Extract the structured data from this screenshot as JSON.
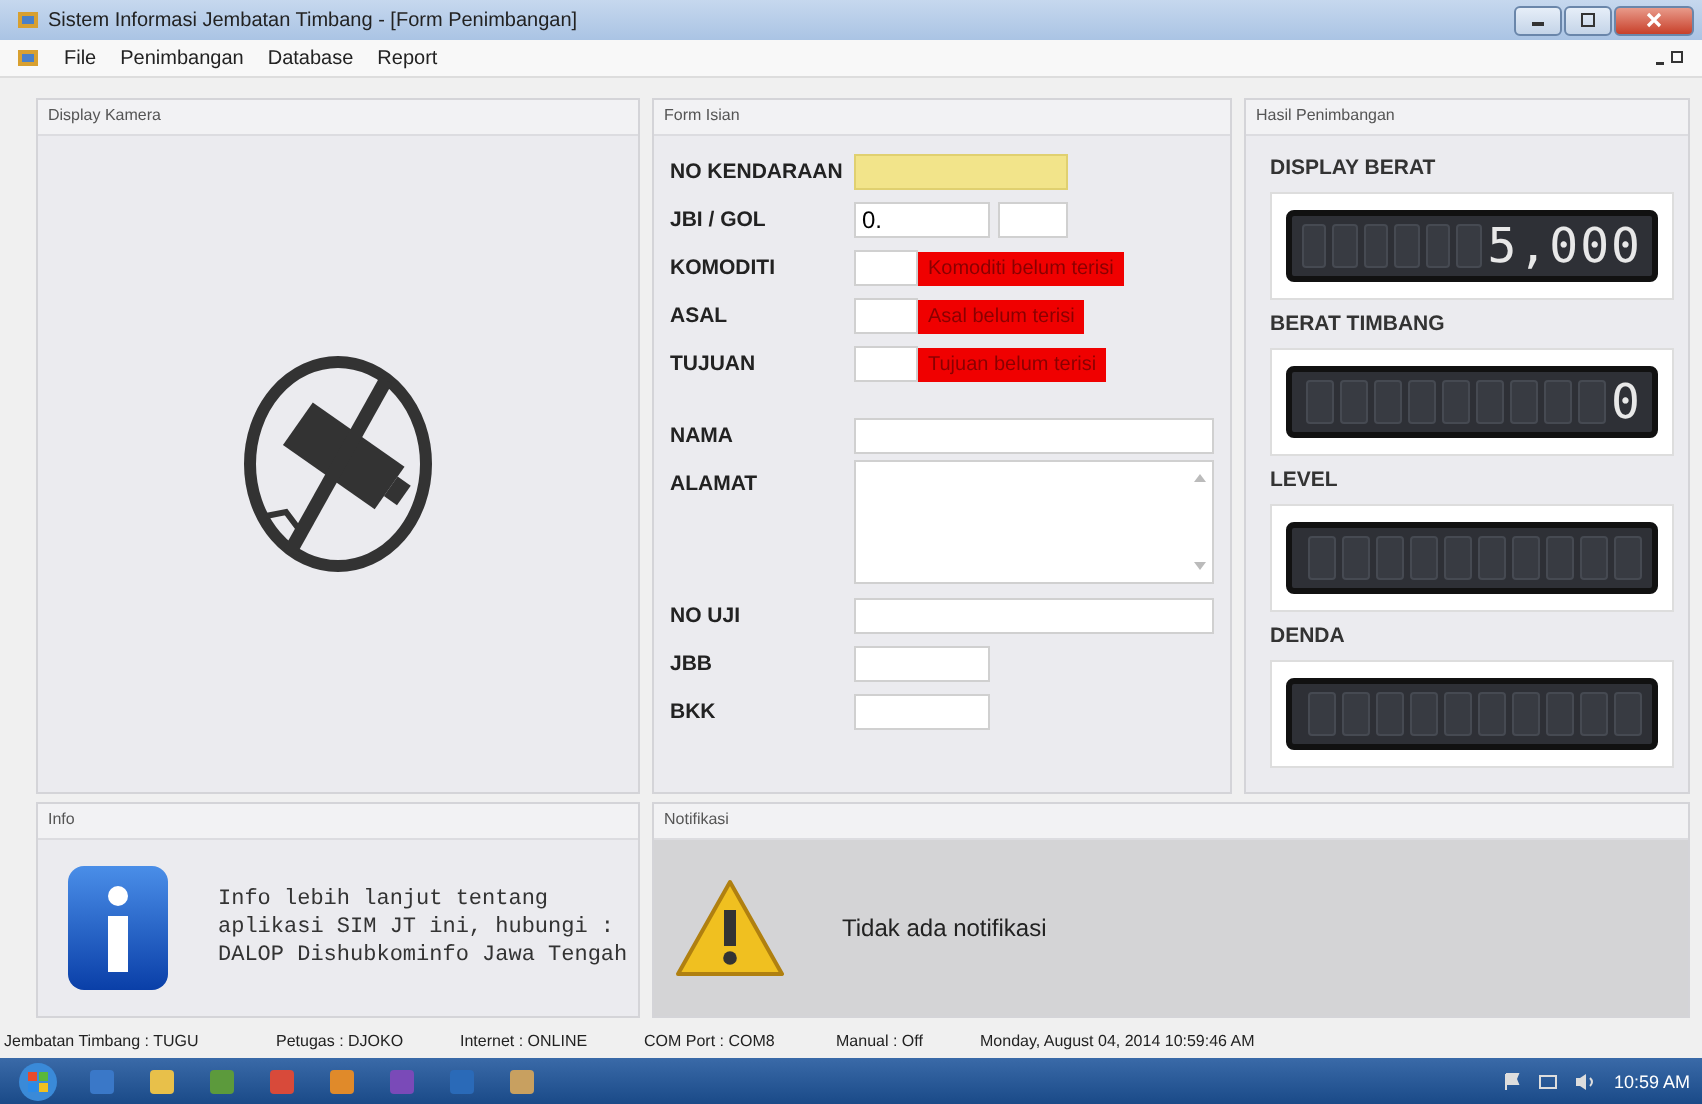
{
  "window": {
    "title": "Sistem Informasi Jembatan Timbang - [Form Penimbangan]"
  },
  "menu": [
    "File",
    "Penimbangan",
    "Database",
    "Report"
  ],
  "camera_panel": {
    "title": "Display Kamera"
  },
  "form_panel": {
    "title": "Form Isian",
    "identity": [
      {
        "label": "NO KENDARAAN",
        "kind": "single",
        "focused": true
      },
      {
        "label": "JBI / GOL",
        "kind": "double",
        "focused": false,
        "values": [
          "0."
        ]
      },
      {
        "label": "KOMODITI",
        "kind": "error",
        "focused": false,
        "error": "Komoditi belum terisi"
      },
      {
        "label": "ASAL",
        "kind": "error",
        "focused": false,
        "error": "Asal belum terisi"
      },
      {
        "label": "TUJUAN",
        "kind": "error",
        "focused": false,
        "error": "Tujuan belum terisi"
      }
    ],
    "owner": [
      {
        "label": "NAMA",
        "kind": "wide"
      },
      {
        "label": "ALAMAT",
        "kind": "textarea"
      },
      {
        "label": "NO UJI",
        "kind": "wide"
      },
      {
        "label": "JBB",
        "kind": "short"
      },
      {
        "label": "BKK",
        "kind": "short"
      }
    ]
  },
  "result_panel": {
    "title": "Hasil Penimbangan",
    "displays": [
      {
        "label": "DISPLAY BERAT",
        "reading": "5,000"
      },
      {
        "label": "BERAT TIMBANG",
        "reading": "0"
      },
      {
        "label": "LEVEL"
      },
      {
        "label": "DENDA"
      }
    ]
  },
  "info_panel": {
    "title": "Info",
    "text": "Info lebih lanjut tentang\naplikasi SIM JT ini, hubungi :\nDALOP Dishubkominfo Jawa Tengah"
  },
  "notification_panel": {
    "title": "Notifikasi",
    "message": "Tidak ada notifikasi"
  },
  "status_bar": [
    "Jembatan Timbang : TUGU",
    "Petugas : DJOKO",
    "Internet : ONLINE",
    "COM Port : COM8",
    "Manual : Off",
    "Monday, August 04, 2014 10:59:46 AM"
  ],
  "taskbar": {
    "clock": "10:59 AM"
  }
}
